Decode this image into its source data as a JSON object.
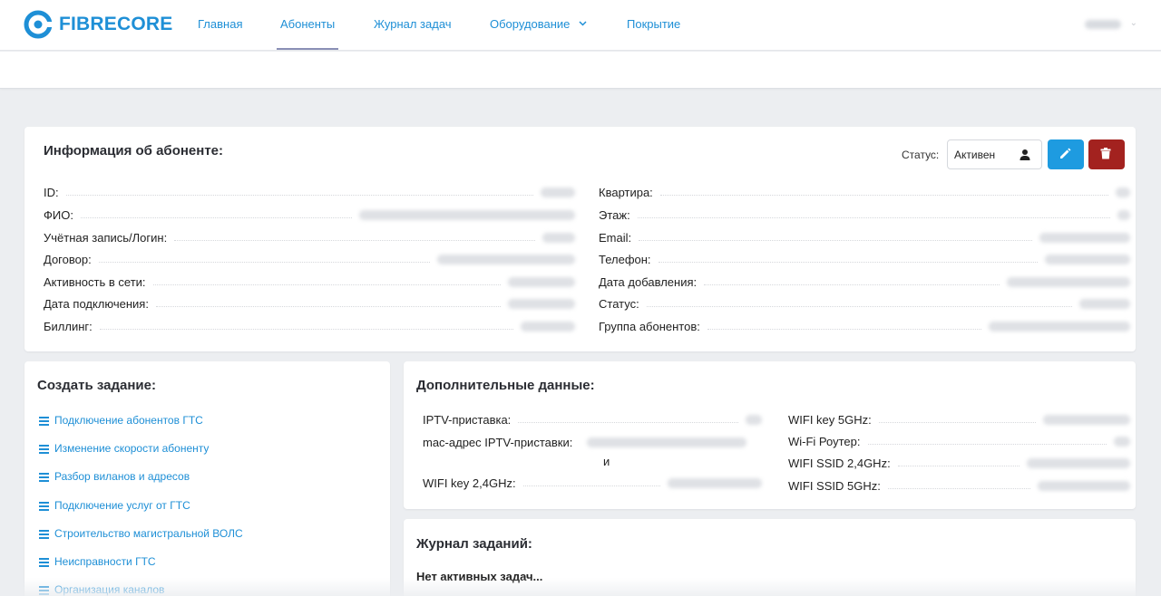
{
  "brand": {
    "name": "FIBRECORE",
    "color": "#1e8fd6",
    "icon": "fibrecore-logo-icon"
  },
  "nav": {
    "items": [
      {
        "label": "Главная"
      },
      {
        "label": "Абоненты",
        "active": true
      },
      {
        "label": "Журнал задач"
      },
      {
        "label": "Оборудование",
        "dropdown": true
      },
      {
        "label": "Покрытие"
      }
    ]
  },
  "subscriber_info": {
    "title": "Информация об абоненте:",
    "status_label": "Статус:",
    "status_value": "Активен",
    "status_icon": "user-icon",
    "edit_icon": "pencil-icon",
    "delete_icon": "trash-icon",
    "left_fields": [
      {
        "label": "ID:"
      },
      {
        "label": "ФИО:"
      },
      {
        "label": "Учётная запись/Логин:"
      },
      {
        "label": "Договор:"
      },
      {
        "label": "Активность в сети:"
      },
      {
        "label": "Дата подключения:"
      },
      {
        "label": "Биллинг:"
      }
    ],
    "right_fields": [
      {
        "label": "Квартира:"
      },
      {
        "label": "Этаж:"
      },
      {
        "label": "Email:"
      },
      {
        "label": "Телефон:"
      },
      {
        "label": "Дата добавления:"
      },
      {
        "label": "Статус:"
      },
      {
        "label": "Группа абонентов:"
      }
    ]
  },
  "create_task": {
    "title": "Создать задание:",
    "icon": "list-icon",
    "items": [
      {
        "label": "Подключение абонентов ГТС"
      },
      {
        "label": "Изменение скорости абоненту"
      },
      {
        "label": "Разбор виланов и адресов"
      },
      {
        "label": "Подключение услуг от ГТС"
      },
      {
        "label": "Строительство магистральной ВОЛС"
      },
      {
        "label": "Неисправности ГТС"
      },
      {
        "label": "Организация каналов"
      }
    ]
  },
  "extra_data": {
    "title": "Дополнительные данные:",
    "left_fields": [
      {
        "label": "IPTV-приставка:"
      },
      {
        "label": "mac-адрес IPTV-приставки:",
        "suffix": "и"
      },
      {
        "label": "WIFI key 2,4GHz:"
      }
    ],
    "right_fields": [
      {
        "label": "WIFI key 5GHz:"
      },
      {
        "label": "Wi-Fi Роутер:"
      },
      {
        "label": "WIFI SSID 2,4GHz:"
      },
      {
        "label": "WIFI SSID 5GHz:"
      }
    ]
  },
  "task_journal": {
    "title": "Журнал заданий:",
    "empty_text": "Нет активных задач..."
  },
  "colors": {
    "primary": "#1e9be0",
    "danger": "#a3221f",
    "link": "#1e8fd6"
  }
}
